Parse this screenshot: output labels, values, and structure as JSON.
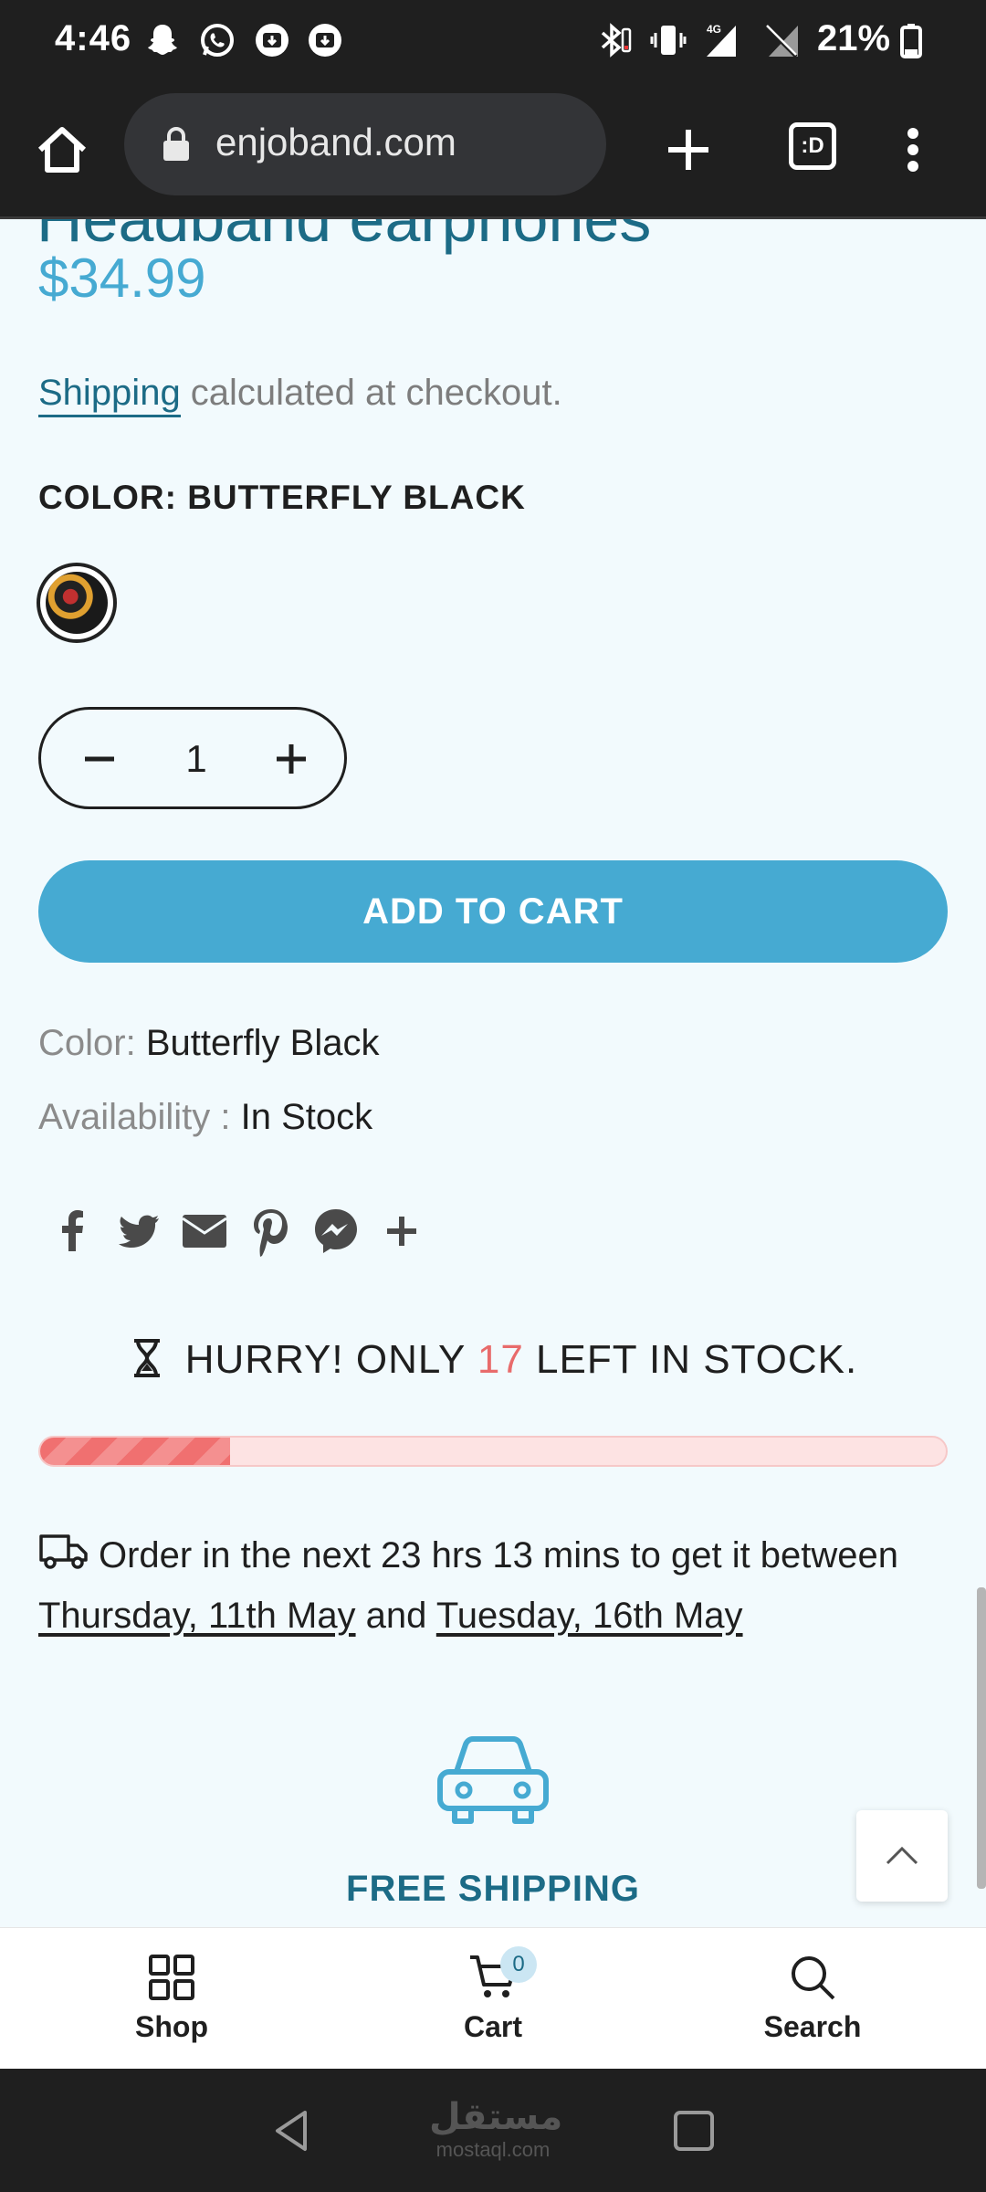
{
  "status_bar": {
    "time": "4:46",
    "network": "4G",
    "battery": "21%"
  },
  "browser": {
    "url": "enjoband.com",
    "tabs_label": ":D"
  },
  "product": {
    "title_partial": "Headband earphones",
    "price": "$34.99",
    "shipping_link": "Shipping",
    "shipping_rest": " calculated at checkout.",
    "color_heading": "COLOR: BUTTERFLY BLACK",
    "quantity": "1",
    "add_to_cart": "ADD TO CART",
    "color_label": "Color:",
    "color_value": "Butterfly Black",
    "availability_label": "Availability :",
    "availability_value": "In Stock"
  },
  "stock": {
    "hurry_prefix": "HURRY! ONLY ",
    "count": "17",
    "hurry_suffix": " LEFT IN STOCK.",
    "fill_percent": 21
  },
  "delivery": {
    "prefix": "Order in the next 23 hrs 13 mins to get it between ",
    "date_start": "Thursday, 11th May",
    "middle": " and ",
    "date_end": "Tuesday, 16th May"
  },
  "feature": {
    "free_shipping": "FREE SHIPPING"
  },
  "bottom_nav": {
    "shop": "Shop",
    "cart": "Cart",
    "cart_count": "0",
    "search": "Search"
  },
  "watermark": {
    "arabic": "مستقل",
    "latin": "mostaql.com"
  },
  "colors": {
    "accent": "#46aad2",
    "title": "#1c6b86",
    "stock_bar": "#f07070",
    "hurry_count": "#e86b6b"
  }
}
